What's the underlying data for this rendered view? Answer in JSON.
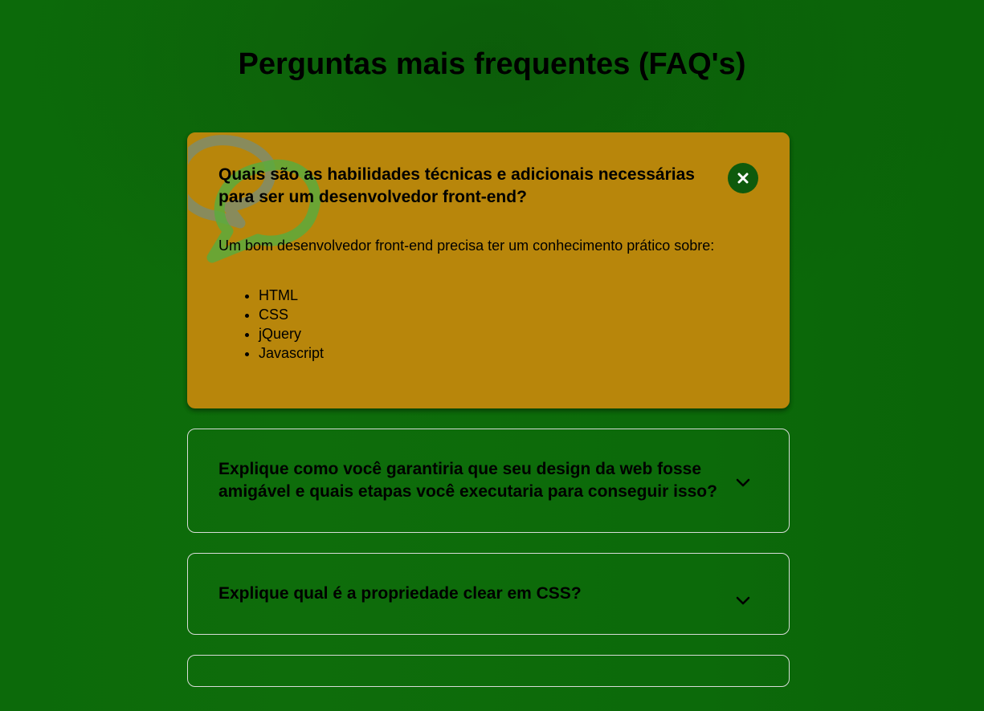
{
  "page": {
    "title": "Perguntas mais frequentes (FAQ's)"
  },
  "colors": {
    "background": "#0d6a0a",
    "active_card": "#b8860b",
    "close_button": "#0e5a0c",
    "border": "#d8dcd8"
  },
  "faqs": [
    {
      "question": "Quais são as habilidades técnicas e adicionais necessárias para ser um desenvolvedor front-end?",
      "answer": "Um bom desenvolvedor front-end precisa ter um conhecimento prático sobre:",
      "list": [
        "HTML",
        "CSS",
        "jQuery",
        "Javascript"
      ],
      "open": true,
      "toggle_icon": "close-icon"
    },
    {
      "question": "Explique como você garantiria que seu design da web fosse amigável e quais etapas você executaria para conseguir isso?",
      "open": false,
      "toggle_icon": "chevron-down-icon"
    },
    {
      "question": "Explique qual é a propriedade clear em CSS?",
      "open": false,
      "toggle_icon": "chevron-down-icon"
    }
  ],
  "watermark_icon": "chat-bubbles-icon"
}
